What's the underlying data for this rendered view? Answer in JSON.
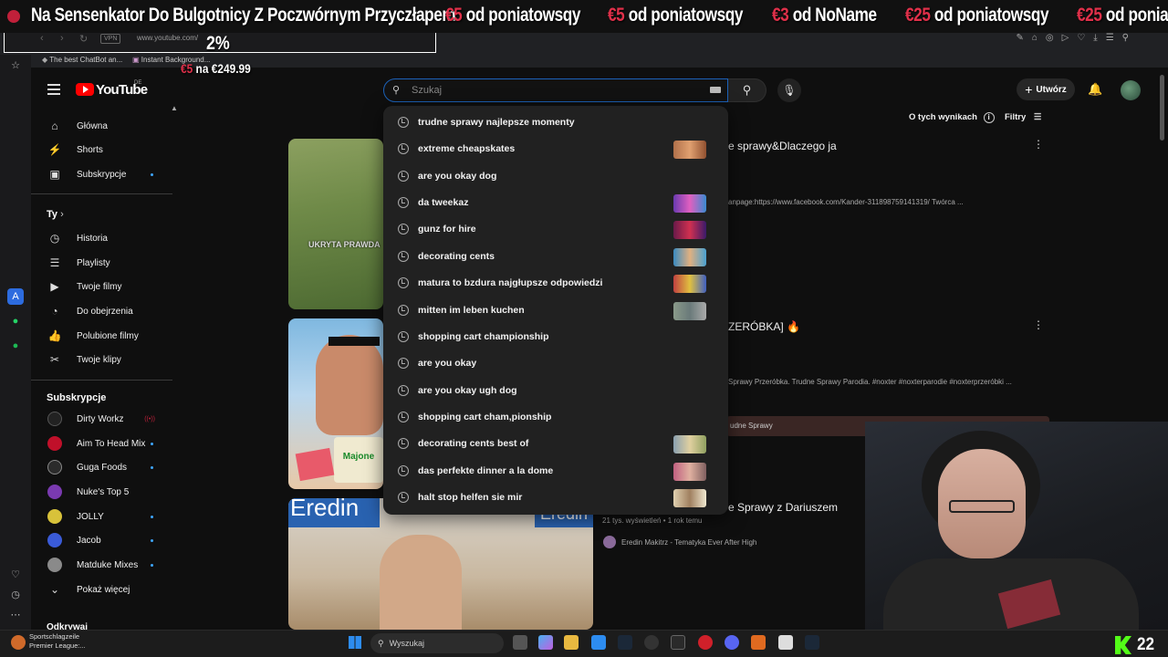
{
  "overlay": {
    "ticker_title": "Na Sensenkator Do Bulgotnicy Z Poczwórnym Przyczłapem",
    "donations": [
      {
        "amount": "€5",
        "text": "od poniatowsqy"
      },
      {
        "amount": "€5",
        "text": "od poniatowsqy"
      },
      {
        "amount": "€3",
        "text": "od NoName"
      },
      {
        "amount": "€25",
        "text": "od poniatowsqy"
      },
      {
        "amount": "€25",
        "text": "od ponia"
      }
    ],
    "goal_percent": "2%",
    "goal_amount": "€5",
    "goal_text": "na €249.99",
    "kick_viewers": "22"
  },
  "browser": {
    "url": "www.youtube.com/",
    "vpn_label": "VPN",
    "bookmarks": [
      "The best ChatBot an...",
      "Instant Background..."
    ]
  },
  "header": {
    "logo": "YouTube",
    "logo_region": "DE",
    "search_placeholder": "Szukaj",
    "create_label": "Utwórz"
  },
  "sidebar": {
    "main": [
      {
        "label": "Główna",
        "icon": "home-icon"
      },
      {
        "label": "Shorts",
        "icon": "shorts-icon"
      },
      {
        "label": "Subskrypcje",
        "icon": "subscriptions-icon"
      }
    ],
    "you_title": "Ty",
    "you": [
      {
        "label": "Historia",
        "icon": "history-icon"
      },
      {
        "label": "Playlisty",
        "icon": "playlist-icon"
      },
      {
        "label": "Twoje filmy",
        "icon": "video-icon"
      },
      {
        "label": "Do obejrzenia",
        "icon": "clock-icon"
      },
      {
        "label": "Polubione filmy",
        "icon": "like-icon"
      },
      {
        "label": "Twoje klipy",
        "icon": "scissors-icon"
      }
    ],
    "subs_title": "Subskrypcje",
    "subs": [
      {
        "label": "Dirty Workz",
        "color": "#222222"
      },
      {
        "label": "Aim To Head Mix",
        "color": "#c0102a"
      },
      {
        "label": "Guga Foods",
        "color": "#2b2b2b"
      },
      {
        "label": "Nuke's Top 5",
        "color": "#7a3ab0"
      },
      {
        "label": "JOLLY",
        "color": "#d8c23a"
      },
      {
        "label": "Jacob",
        "color": "#3a5bd8"
      },
      {
        "label": "Matduke Mixes",
        "color": "#8a8a8a"
      }
    ],
    "show_more": "Pokaż więcej",
    "next_section": "Odkrywaj"
  },
  "results": {
    "about_label": "O tych wynikach",
    "filters_label": "Filtry",
    "items": [
      {
        "title": "e sprawy&Dlaczego ja",
        "desc": "anpage:https://www.facebook.com/Kander-311898759141319/ Twórca ..."
      },
      {
        "title": "ZERÓBKA] 🔥",
        "desc": "Sprawy Przeróbka. Trudne Sprawy Parodia. #noxter #noxterparodie #noxterprzeróbki ...",
        "chapter": "udne Sprawy"
      },
      {
        "title": "e Sprawy z Dariuszem",
        "meta": "21 tys. wyświetleń • 1 rok temu",
        "channel": "Eredin Makitrz - Tematyka Ever After High",
        "thumb_text": "Eredin"
      }
    ],
    "thumb_caption": "UKRYTA PRAWDA",
    "thumb_label_2": "Majone"
  },
  "suggestions": [
    "trudne sprawy najlepsze momenty",
    "extreme cheapskates",
    "are you okay dog",
    "da tweekaz",
    "gunz for hire",
    "decorating cents",
    "matura to bzdura najgłupsze odpowiedzi",
    "mitten im leben kuchen",
    "shopping cart championship",
    "are you okay",
    "are you okay ugh dog",
    "shopping cart cham,pionship",
    "decorating cents best of",
    "das perfekte dinner a la dome",
    "halt stop helfen sie mir"
  ],
  "taskbar": {
    "search_label": "Wyszukaj",
    "news_title": "Sportschlagzeile",
    "news_sub": "Premier League:..."
  },
  "colors": {
    "accent": "#3ea6ff",
    "brand": "#ff0000",
    "donation": "#e0304a"
  }
}
